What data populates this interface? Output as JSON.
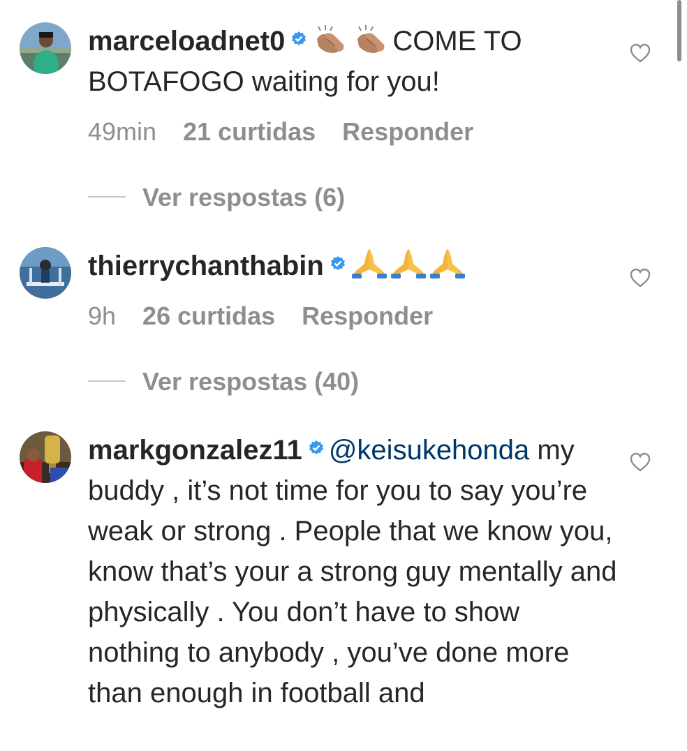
{
  "comments": [
    {
      "username": "marceloadnet0",
      "text": "COME TO BOTAFOGO waiting for you!",
      "emojis": [
        "clapping-hands",
        "clapping-hands"
      ],
      "time": "49min",
      "likes": "21 curtidas",
      "reply_label": "Responder",
      "view_replies": "Ver respostas (6)"
    },
    {
      "username": "thierrychanthabin",
      "text": "",
      "emojis": [
        "folded-hands",
        "folded-hands",
        "folded-hands"
      ],
      "time": "9h",
      "likes": "26 curtidas",
      "reply_label": "Responder",
      "view_replies": "Ver respostas (40)"
    },
    {
      "username": "markgonzalez11",
      "mention": "@keisukehonda",
      "text": "my buddy , it’s not time for you to say you’re weak or strong . People that we know you, know that’s your a strong guy mentally and physically . You don’t have to show nothing to anybody , you’ve done more than enough in football and"
    }
  ],
  "colors": {
    "text": "#262626",
    "secondary": "#8e8e8e",
    "verified": "#3897f0",
    "mention": "#00376b"
  }
}
